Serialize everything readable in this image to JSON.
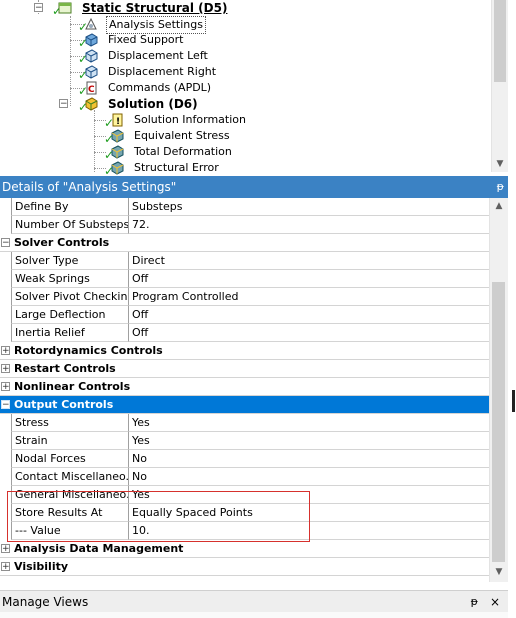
{
  "tree": {
    "nodes": [
      {
        "label": "Static Structural (D5)",
        "icon": "static-structural-icon",
        "expander": "−"
      },
      {
        "label": "Analysis Settings",
        "icon": "analysis-settings-icon"
      },
      {
        "label": "Fixed Support",
        "icon": "fixed-support-icon"
      },
      {
        "label": "Displacement Left",
        "icon": "displacement-icon"
      },
      {
        "label": "Displacement Right",
        "icon": "displacement-icon"
      },
      {
        "label": "Commands (APDL)",
        "icon": "commands-apdl-icon"
      },
      {
        "label": "Solution (D6)",
        "icon": "solution-icon",
        "expander": "−"
      },
      {
        "label": "Solution Information",
        "icon": "solution-information-icon"
      },
      {
        "label": "Equivalent Stress",
        "icon": "equivalent-stress-icon"
      },
      {
        "label": "Total Deformation",
        "icon": "total-deformation-icon"
      },
      {
        "label": "Structural Error",
        "icon": "structural-error-icon"
      }
    ]
  },
  "details": {
    "title": "Details of \"Analysis Settings\"",
    "pin_icon": "ᵽ",
    "rows": [
      {
        "type": "prop",
        "name": "Define By",
        "value": "Substeps"
      },
      {
        "type": "prop",
        "name": "Number Of Substeps",
        "value": "72."
      },
      {
        "type": "cat",
        "name": "Solver Controls",
        "expander": "−"
      },
      {
        "type": "prop",
        "name": "Solver Type",
        "value": "Direct"
      },
      {
        "type": "prop",
        "name": "Weak Springs",
        "value": "Off"
      },
      {
        "type": "prop",
        "name": "Solver Pivot Checking",
        "value": "Program Controlled"
      },
      {
        "type": "prop",
        "name": "Large Deflection",
        "value": "Off"
      },
      {
        "type": "prop",
        "name": "Inertia Relief",
        "value": "Off"
      },
      {
        "type": "cat",
        "name": "Rotordynamics Controls",
        "expander": "+"
      },
      {
        "type": "cat",
        "name": "Restart Controls",
        "expander": "+"
      },
      {
        "type": "cat",
        "name": "Nonlinear Controls",
        "expander": "+"
      },
      {
        "type": "cat",
        "name": "Output Controls",
        "expander": "−",
        "active": true
      },
      {
        "type": "prop",
        "name": "Stress",
        "value": "Yes"
      },
      {
        "type": "prop",
        "name": "Strain",
        "value": "Yes"
      },
      {
        "type": "prop",
        "name": "Nodal Forces",
        "value": "No"
      },
      {
        "type": "prop",
        "name": "Contact Miscellaneo...",
        "value": "No"
      },
      {
        "type": "prop",
        "name": "General Miscellaneo...",
        "value": "Yes"
      },
      {
        "type": "prop",
        "name": "Store Results At",
        "value": "Equally Spaced Points"
      },
      {
        "type": "prop",
        "name": "--- Value",
        "value": "10."
      },
      {
        "type": "cat",
        "name": "Analysis Data Management",
        "expander": "+"
      },
      {
        "type": "cat",
        "name": "Visibility",
        "expander": "+"
      }
    ]
  },
  "manage_views": {
    "title": "Manage Views",
    "pin_icon": "ᵽ",
    "close_icon": "×"
  },
  "colors": {
    "header_blue": "#3b82c4",
    "selected_blue": "#0078d7",
    "highlight_red": "#d6312d",
    "check_green": "#1f9d1f"
  }
}
